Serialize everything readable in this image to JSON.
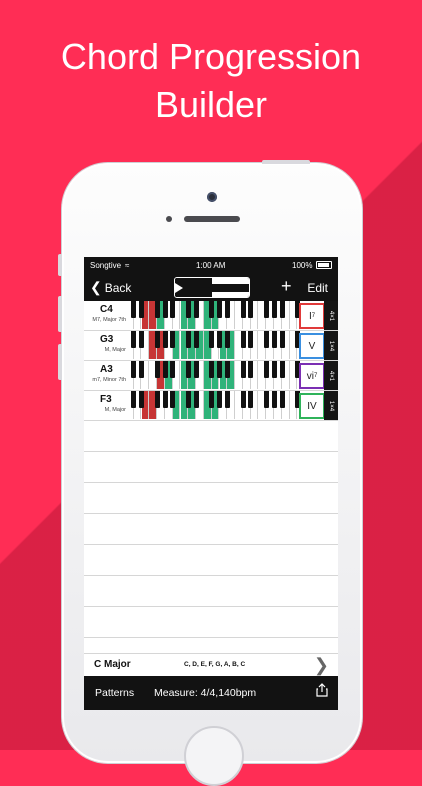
{
  "headline": {
    "line1": "Chord Progression",
    "line2": "Builder"
  },
  "status_bar": {
    "carrier": "Songtive",
    "time": "1:00 AM",
    "battery": "100%"
  },
  "nav": {
    "back_label": "Back",
    "edit_label": "Edit"
  },
  "chords": [
    {
      "name": "C4",
      "desc": "M7, Major 7th",
      "numeral": "I",
      "sup": "7",
      "repeat": "4×1",
      "color": "#e03a3a",
      "keys": [
        {
          "w": 2,
          "c": "#c73535"
        },
        {
          "w": 3,
          "c": "#c73535"
        },
        {
          "w": 4,
          "c": "#2fb37a"
        },
        {
          "w": 7,
          "c": "#2fb37a"
        },
        {
          "w": 8,
          "c": "#2fb37a"
        },
        {
          "w": 10,
          "c": "#2fb37a"
        },
        {
          "w": 11,
          "c": "#2fb37a"
        }
      ]
    },
    {
      "name": "G3",
      "desc": "M, Major",
      "numeral": "V",
      "sup": "",
      "repeat": "1×4",
      "color": "#3a8fe0",
      "keys": [
        {
          "w": 3,
          "c": "#c73535"
        },
        {
          "w": 4,
          "c": "#c73535"
        },
        {
          "w": 6,
          "c": "#2fb37a"
        },
        {
          "w": 7,
          "c": "#2fb37a"
        },
        {
          "w": 8,
          "c": "#2fb37a"
        },
        {
          "w": 9,
          "c": "#2fb37a"
        },
        {
          "w": 10,
          "c": "#2fb37a"
        },
        {
          "w": 12,
          "c": "#2fb37a"
        },
        {
          "w": 13,
          "c": "#2fb37a"
        }
      ]
    },
    {
      "name": "A3",
      "desc": "m7, Minor 7th",
      "numeral": "vi",
      "sup": "7",
      "repeat": "4×1",
      "color": "#7b2fb3",
      "keys": [
        {
          "w": 4,
          "c": "#c73535"
        },
        {
          "w": 5,
          "c": "#2fb37a"
        },
        {
          "w": 7,
          "c": "#2fb37a"
        },
        {
          "w": 8,
          "c": "#2fb37a"
        },
        {
          "w": 10,
          "c": "#2fb37a"
        },
        {
          "w": 11,
          "c": "#2fb37a"
        },
        {
          "w": 12,
          "c": "#2fb37a"
        },
        {
          "w": 13,
          "c": "#2fb37a"
        }
      ]
    },
    {
      "name": "F3",
      "desc": "M, Major",
      "numeral": "IV",
      "sup": "",
      "repeat": "1×4",
      "color": "#2fb35a",
      "keys": [
        {
          "w": 2,
          "c": "#c73535"
        },
        {
          "w": 3,
          "c": "#c73535"
        },
        {
          "w": 6,
          "c": "#2fb37a"
        },
        {
          "w": 7,
          "c": "#2fb37a"
        },
        {
          "w": 8,
          "c": "#2fb37a"
        },
        {
          "w": 10,
          "c": "#2fb37a"
        },
        {
          "w": 11,
          "c": "#2fb37a"
        }
      ]
    }
  ],
  "key_bar": {
    "key": "C Major",
    "notes": "C, D, E, F, G, A, B, C"
  },
  "toolbar": {
    "patterns_label": "Patterns",
    "measure_label": "Measure: 4/4,140bpm"
  }
}
